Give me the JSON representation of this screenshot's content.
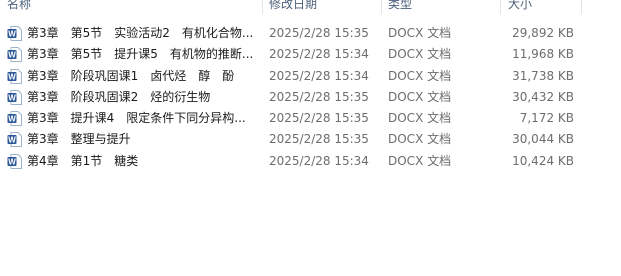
{
  "columns": {
    "name": "名称",
    "date": "修改日期",
    "type": "类型",
    "size": "大小"
  },
  "files": [
    {
      "name": "第3章　第5节　实验活动2　有机化合物...",
      "date": "2025/2/28 15:35",
      "type": "DOCX 文档",
      "size": "29,892 KB"
    },
    {
      "name": "第3章　第5节　提升课5　有机物的推断...",
      "date": "2025/2/28 15:34",
      "type": "DOCX 文档",
      "size": "11,968 KB"
    },
    {
      "name": "第3章　阶段巩固课1　卤代烃　醇　酚",
      "date": "2025/2/28 15:34",
      "type": "DOCX 文档",
      "size": "31,738 KB"
    },
    {
      "name": "第3章　阶段巩固课2　烃的衍生物",
      "date": "2025/2/28 15:35",
      "type": "DOCX 文档",
      "size": "30,432 KB"
    },
    {
      "name": "第3章　提升课4　限定条件下同分异构...",
      "date": "2025/2/28 15:35",
      "type": "DOCX 文档",
      "size": "7,172 KB"
    },
    {
      "name": "第3章　整理与提升",
      "date": "2025/2/28 15:35",
      "type": "DOCX 文档",
      "size": "30,044 KB"
    },
    {
      "name": "第4章　第1节　糖类",
      "date": "2025/2/28 15:34",
      "type": "DOCX 文档",
      "size": "10,424 KB"
    }
  ],
  "icon": "word-document-icon",
  "colors": {
    "word_blue": "#2b5797",
    "header_text": "#4c607a",
    "secondary_text": "#6d6d6d"
  }
}
